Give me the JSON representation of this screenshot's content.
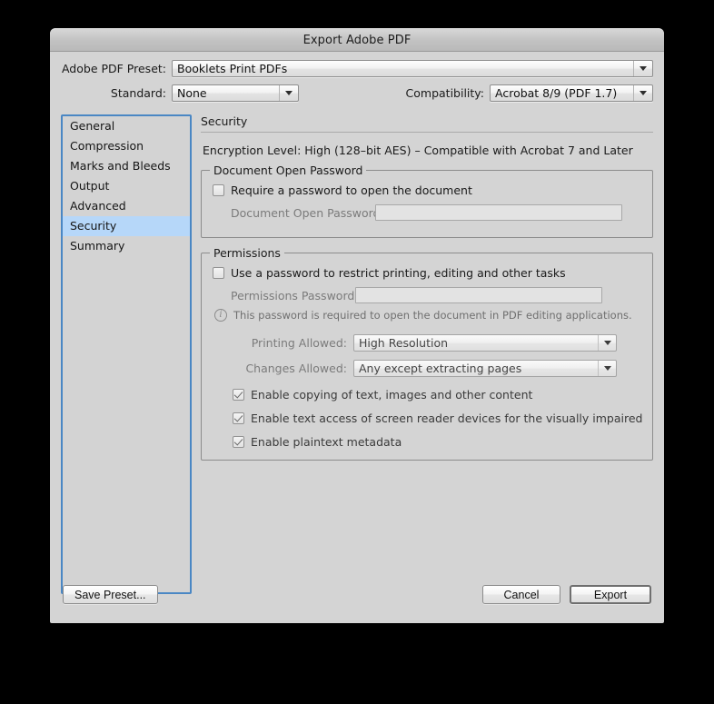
{
  "window": {
    "title": "Export Adobe PDF"
  },
  "preset_row": {
    "label": "Adobe PDF Preset:",
    "value": "Booklets Print PDFs"
  },
  "standard_row": {
    "label": "Standard:",
    "value": "None"
  },
  "compatibility_row": {
    "label": "Compatibility:",
    "value": "Acrobat 8/9 (PDF 1.7)"
  },
  "sidebar": {
    "items": [
      {
        "label": "General",
        "selected": false
      },
      {
        "label": "Compression",
        "selected": false
      },
      {
        "label": "Marks and Bleeds",
        "selected": false
      },
      {
        "label": "Output",
        "selected": false
      },
      {
        "label": "Advanced",
        "selected": false
      },
      {
        "label": "Security",
        "selected": true
      },
      {
        "label": "Summary",
        "selected": false
      }
    ]
  },
  "panel": {
    "title": "Security",
    "encryption_level": "Encryption Level: High (128–bit AES) – Compatible with Acrobat 7 and Later",
    "document_open_password": {
      "legend": "Document Open Password",
      "require_checkbox_label": "Require a password to open the document",
      "require_checkbox_checked": false,
      "password_label": "Document Open Password:",
      "password_value": "",
      "password_placeholder": ""
    },
    "permissions": {
      "legend": "Permissions",
      "use_password_checkbox_label": "Use a password to restrict printing, editing and other tasks",
      "use_password_checkbox_checked": false,
      "password_label": "Permissions Password:",
      "password_value": "",
      "password_placeholder": "",
      "info_icon": "info-circle-icon",
      "info_note": "This password is required to open the document in PDF editing applications.",
      "printing_allowed_label": "Printing Allowed:",
      "printing_allowed_value": "High Resolution",
      "changes_allowed_label": "Changes Allowed:",
      "changes_allowed_value": "Any except extracting pages",
      "checkboxes": [
        {
          "label": "Enable copying of text, images and other content",
          "checked": true
        },
        {
          "label": "Enable text access of screen reader devices for the visually impaired",
          "checked": true
        },
        {
          "label": "Enable plaintext metadata",
          "checked": true
        }
      ]
    }
  },
  "footer": {
    "save_preset_label": "Save Preset...",
    "cancel_label": "Cancel",
    "export_label": "Export"
  },
  "colors": {
    "window_bg": "#d4d4d4",
    "selection_blue": "#b6d7f9",
    "focus_border_blue": "#4a87c4",
    "desktop_bg": "#000000"
  }
}
